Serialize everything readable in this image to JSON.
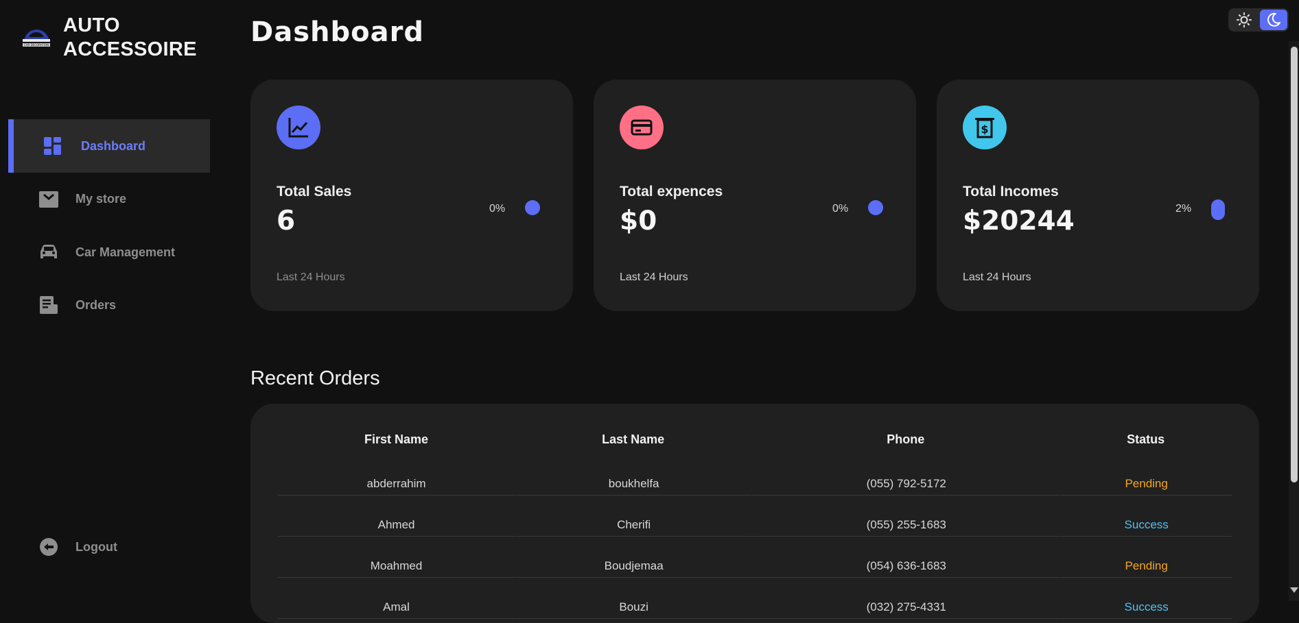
{
  "brand": {
    "name_line1": "AUTO",
    "name_line2": "ACCESSOIRE",
    "logo_text": "CAR DECORATION"
  },
  "sidebar": {
    "items": [
      {
        "label": "Dashboard",
        "icon": "dashboard-grid-icon",
        "active": true
      },
      {
        "label": "My store",
        "icon": "store-icon",
        "active": false
      },
      {
        "label": "Car Management",
        "icon": "car-icon",
        "active": false
      },
      {
        "label": "Orders",
        "icon": "receipt-icon",
        "active": false
      }
    ],
    "logout": {
      "label": "Logout",
      "icon": "logout-icon"
    }
  },
  "header": {
    "title": "Dashboard"
  },
  "theme_toggle": {
    "light_icon": "sun-icon",
    "dark_icon": "moon-icon",
    "selected": "dark"
  },
  "cards": [
    {
      "title": "Total Sales",
      "value": "6",
      "percent": "0%",
      "footer": "Last 24 Hours",
      "icon": "line-chart-icon",
      "icon_color": "#5b6ef5"
    },
    {
      "title": "Total expences",
      "value": "$0",
      "percent": "0%",
      "footer": "Last 24 Hours",
      "icon": "credit-card-icon",
      "icon_color": "#ff7086"
    },
    {
      "title": "Total Incomes",
      "value": "$20244",
      "percent": "2%",
      "footer": "Last 24 Hours",
      "icon": "money-bill-icon",
      "icon_color": "#41c7eb"
    }
  ],
  "orders": {
    "title": "Recent Orders",
    "columns": [
      "First Name",
      "Last Name",
      "Phone",
      "Status"
    ],
    "rows": [
      {
        "first": "abderrahim",
        "last": "boukhelfa",
        "phone": "(055) 792-5172",
        "status": "Pending"
      },
      {
        "first": "Ahmed",
        "last": "Cherifi",
        "phone": "(055) 255-1683",
        "status": "Success"
      },
      {
        "first": "Moahmed",
        "last": "Boudjemaa",
        "phone": "(054) 636-1683",
        "status": "Pending"
      },
      {
        "first": "Amal",
        "last": "Bouzi",
        "phone": "(032) 275-4331",
        "status": "Success"
      }
    ]
  },
  "colors": {
    "accent": "#5b6ef5",
    "pending": "#f5a623",
    "success": "#4fc3f7",
    "background": "#111111",
    "card": "#202020"
  }
}
